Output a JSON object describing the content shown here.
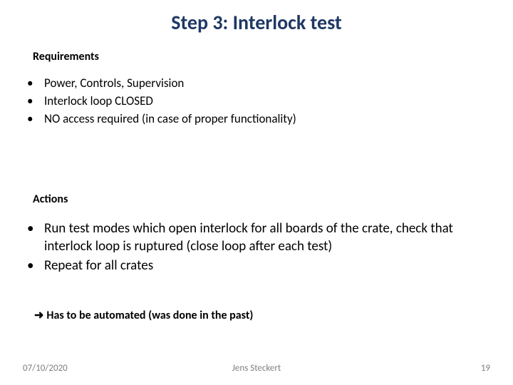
{
  "title": "Step 3: Interlock test",
  "sections": {
    "requirements": {
      "label": "Requirements",
      "items": [
        "Power, Controls, Supervision",
        "Interlock loop CLOSED",
        "NO access required (in case of proper functionality)"
      ]
    },
    "actions": {
      "label": "Actions",
      "items": [
        "Run test modes which open interlock for all boards of the crate, check that interlock loop is ruptured (close loop after each test)",
        "Repeat for all crates"
      ]
    }
  },
  "conclusion": {
    "arrow": "➜",
    "text": "Has to be automated (was done in the past)"
  },
  "footer": {
    "date": "07/10/2020",
    "author": "Jens Steckert",
    "page": "19"
  }
}
